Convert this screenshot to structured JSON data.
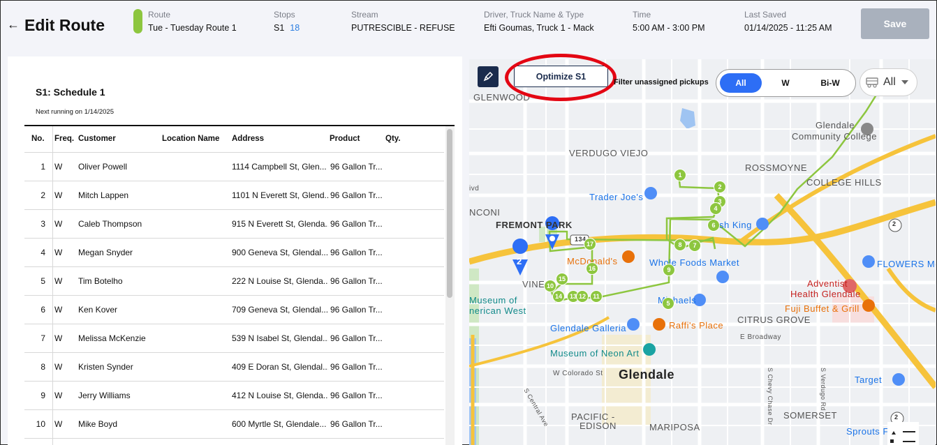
{
  "header": {
    "back_icon": "←",
    "title": "Edit Route",
    "route_color": "#8dc63f",
    "route_label": "Route",
    "route_value": "Tue - Tuesday Route 1",
    "stops_label": "Stops",
    "stops_schedule": "S1",
    "stops_count": "18",
    "stream_label": "Stream",
    "stream_value": "PUTRESCIBLE - REFUSE",
    "driver_label": "Driver, Truck Name & Type",
    "driver_value": "Efti Goumas, Truck 1 - Mack",
    "time_label": "Time",
    "time_value": "5:00 AM - 3:00 PM",
    "saved_label": "Last Saved",
    "saved_value": "01/14/2025 - 11:25 AM",
    "save_button": "Save"
  },
  "schedule": {
    "title": "S1:  Schedule 1",
    "next_running": "Next running on 1/14/2025"
  },
  "table": {
    "columns": [
      "No.",
      "Freq.",
      "Customer",
      "Location Name",
      "Address",
      "Product",
      "Qty."
    ],
    "rows": [
      {
        "no": "1",
        "freq": "W",
        "customer": "Oliver Powell",
        "location": "",
        "address": "1114 Campbell St, Glen...",
        "product": "96 Gallon Tr...",
        "qty": ""
      },
      {
        "no": "2",
        "freq": "W",
        "customer": "Mitch Lappen",
        "location": "",
        "address": "1101 N Everett St, Glend...",
        "product": "96 Gallon Tr...",
        "qty": ""
      },
      {
        "no": "3",
        "freq": "W",
        "customer": "Caleb Thompson",
        "location": "",
        "address": "915 N Everett St, Glenda...",
        "product": "96 Gallon Tr...",
        "qty": ""
      },
      {
        "no": "4",
        "freq": "W",
        "customer": "Megan Snyder",
        "location": "",
        "address": "900 Geneva St, Glendal...",
        "product": "96 Gallon Tr...",
        "qty": ""
      },
      {
        "no": "5",
        "freq": "W",
        "customer": "Tim Botelho",
        "location": "",
        "address": "222 N Louise St, Glenda...",
        "product": "96 Gallon Tr...",
        "qty": ""
      },
      {
        "no": "6",
        "freq": "W",
        "customer": "Ken Kover",
        "location": "",
        "address": "709 Geneva St, Glendal...",
        "product": "96 Gallon Tr...",
        "qty": ""
      },
      {
        "no": "7",
        "freq": "W",
        "customer": "Melissa McKenzie",
        "location": "",
        "address": "539 N Isabel St, Glendal...",
        "product": "96 Gallon Tr...",
        "qty": ""
      },
      {
        "no": "8",
        "freq": "W",
        "customer": "Kristen Synder",
        "location": "",
        "address": "409 E Doran St, Glendal...",
        "product": "96 Gallon Tr...",
        "qty": ""
      },
      {
        "no": "9",
        "freq": "W",
        "customer": "Jerry Williams",
        "location": "",
        "address": "412 N Louise St, Glenda...",
        "product": "96 Gallon Tr...",
        "qty": ""
      },
      {
        "no": "10",
        "freq": "W",
        "customer": "Mike Boyd",
        "location": "",
        "address": "600 Myrtle St, Glendale...",
        "product": "96 Gallon Tr...",
        "qty": ""
      }
    ]
  },
  "map": {
    "optimize_button": "Optimize S1",
    "filter_label": "Filter unassigned pickups",
    "filter_options": [
      "All",
      "W",
      "Bi-W"
    ],
    "filter_selected": "All",
    "dropdown_value": "All",
    "accent": "#2d6ef5",
    "route_line_color": "#8dc63f",
    "highlight_color": "#e30613",
    "labels": {
      "glenwood": "GLENWOOD",
      "verdugo": "VERDUGO VIEJO",
      "rossmoyne": "ROSSMOYNE",
      "college_hills": "COLLEGE HILLS",
      "glendale_cc_1": "Glendale",
      "glendale_cc_2": "Community College",
      "traders": "Trader Joe's",
      "fremont": "FREMONT PARK",
      "nconi": "NCONI",
      "mcdonalds": "McDonald's",
      "whole_foods": "Whole Foods Market",
      "flowers": "FLOWERS McKENZIE",
      "vine": "VINE",
      "museum_1": "Museum of",
      "museum_2": "nerican West",
      "michaels": "Michaels",
      "adventist_1": "Adventist",
      "adventist_2": "Health Glendale",
      "fuji": "Fuji Buffet & Grill",
      "galleria": "Glendale Galleria",
      "raffis": "Raffi's Place",
      "citrus": "CITRUS GROVE",
      "broadway": "E Broadway",
      "neon": "Museum of Neon Art",
      "glendale": "Glendale",
      "colorado": "W Colorado St",
      "target": "Target",
      "pacific_1": "PACIFIC -",
      "pacific_2": "EDISON",
      "mariposa": "MARIPOSA",
      "somerset": "SOMERSET",
      "sprouts": "Sprouts F",
      "ish_king": "sh King",
      "ivd": "ivd",
      "hwy_134": "134",
      "hwy_2a": "2",
      "hwy_2b": "2",
      "pin_2": "2",
      "s_central": "S Central Ave",
      "s_chevy": "S Chevy Chase Dr",
      "s_verdugo": "S Verdugo Rd"
    },
    "stops": [
      "1",
      "2",
      "3",
      "4",
      "6",
      "7",
      "8",
      "9",
      "17",
      "16",
      "15",
      "10",
      "14",
      "13",
      "12",
      "11",
      "5"
    ]
  }
}
